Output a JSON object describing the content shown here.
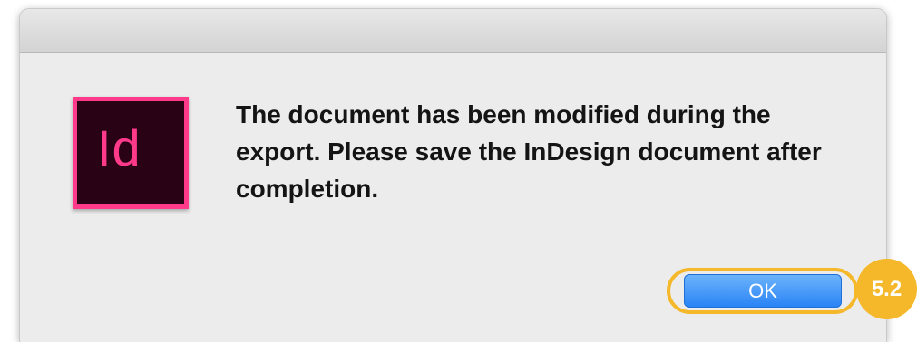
{
  "dialog": {
    "app_icon": {
      "icon": "indesign-app-icon",
      "label": "Id",
      "colors": {
        "background": "#2a0216",
        "accent": "#ff3a8a"
      }
    },
    "message": "The document has been modified during the export. Please save the InDesign document after completion.",
    "ok_button_label": "OK"
  },
  "annotation": {
    "step_label": "5.2",
    "color": "#f5b82a"
  },
  "colors": {
    "button_blue": "#2a84f5",
    "dialog_background": "#ececec"
  }
}
